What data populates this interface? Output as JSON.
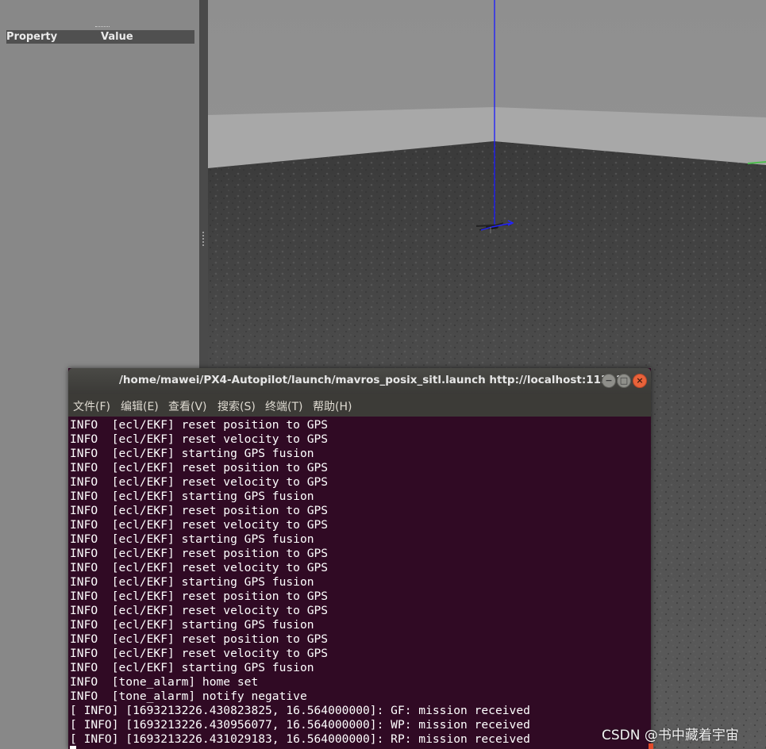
{
  "property_panel": {
    "header_property": "Property",
    "header_value": "Value"
  },
  "terminal": {
    "title": "/home/mawei/PX4-Autopilot/launch/mavros_posix_sitl.launch http://localhost:11311",
    "window_buttons": {
      "minimize": "−",
      "maximize": "□",
      "close": "×"
    },
    "menu": [
      "文件(F)",
      "编辑(E)",
      "查看(V)",
      "搜索(S)",
      "终端(T)",
      "帮助(H)"
    ],
    "lines": [
      "INFO  [ecl/EKF] reset position to GPS",
      "INFO  [ecl/EKF] reset velocity to GPS",
      "INFO  [ecl/EKF] starting GPS fusion",
      "INFO  [ecl/EKF] reset position to GPS",
      "INFO  [ecl/EKF] reset velocity to GPS",
      "INFO  [ecl/EKF] starting GPS fusion",
      "INFO  [ecl/EKF] reset position to GPS",
      "INFO  [ecl/EKF] reset velocity to GPS",
      "INFO  [ecl/EKF] starting GPS fusion",
      "INFO  [ecl/EKF] reset position to GPS",
      "INFO  [ecl/EKF] reset velocity to GPS",
      "INFO  [ecl/EKF] starting GPS fusion",
      "INFO  [ecl/EKF] reset position to GPS",
      "INFO  [ecl/EKF] reset velocity to GPS",
      "INFO  [ecl/EKF] starting GPS fusion",
      "INFO  [ecl/EKF] reset position to GPS",
      "INFO  [ecl/EKF] reset velocity to GPS",
      "INFO  [ecl/EKF] starting GPS fusion",
      "INFO  [tone_alarm] home set",
      "INFO  [tone_alarm] notify negative",
      "[ INFO] [1693213226.430823825, 16.564000000]: GF: mission received",
      "[ INFO] [1693213226.430956077, 16.564000000]: WP: mission received",
      "[ INFO] [1693213226.431029183, 16.564000000]: RP: mission received"
    ]
  },
  "watermark": "CSDN @书中藏着宇宙",
  "colors": {
    "terminal_bg": "#300a24",
    "titlebar_bg": "#3c3b37",
    "close_button": "#e9633a",
    "z_axis": "#1a1aff"
  }
}
